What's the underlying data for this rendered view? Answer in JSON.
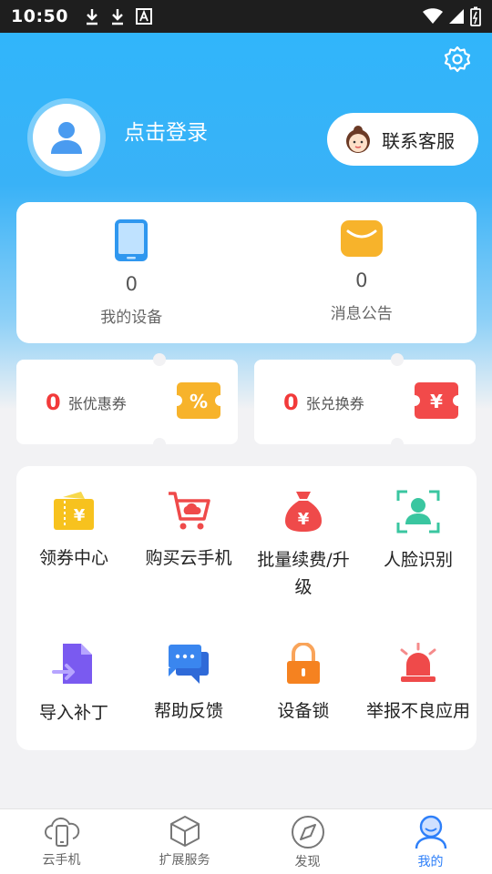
{
  "status_bar": {
    "time": "10:50"
  },
  "header": {
    "login_text": "点击登录",
    "service_button_label": "联系客服"
  },
  "stats": [
    {
      "value": "0",
      "label": "我的设备",
      "icon": "phone-icon"
    },
    {
      "value": "0",
      "label": "消息公告",
      "icon": "mail-icon"
    }
  ],
  "tickets": [
    {
      "count": "0",
      "label": "张优惠券",
      "icon": "percent-ticket-icon",
      "color": "#f7b32b"
    },
    {
      "count": "0",
      "label": "张兑换券",
      "icon": "yen-ticket-icon",
      "color": "#f24a4a"
    }
  ],
  "features": [
    {
      "label": "领券中心",
      "icon": "coupon-center-icon"
    },
    {
      "label": "购买云手机",
      "icon": "cart-cloud-icon"
    },
    {
      "label": "批量续费/升级",
      "icon": "money-bag-icon"
    },
    {
      "label": "人脸识别",
      "icon": "face-id-icon"
    },
    {
      "label": "导入补丁",
      "icon": "import-patch-icon"
    },
    {
      "label": "帮助反馈",
      "icon": "chat-feedback-icon"
    },
    {
      "label": "设备锁",
      "icon": "lock-icon"
    },
    {
      "label": "举报不良应用",
      "icon": "alarm-icon"
    }
  ],
  "tabs": [
    {
      "label": "云手机",
      "icon": "cloud-phone-icon",
      "active": false
    },
    {
      "label": "扩展服务",
      "icon": "box-icon",
      "active": false
    },
    {
      "label": "发现",
      "icon": "compass-icon",
      "active": false
    },
    {
      "label": "我的",
      "icon": "profile-icon",
      "active": true
    }
  ],
  "colors": {
    "primary_blue": "#2fb6fb",
    "active_tab": "#2d7ff9",
    "count_red": "#f23a3a"
  }
}
